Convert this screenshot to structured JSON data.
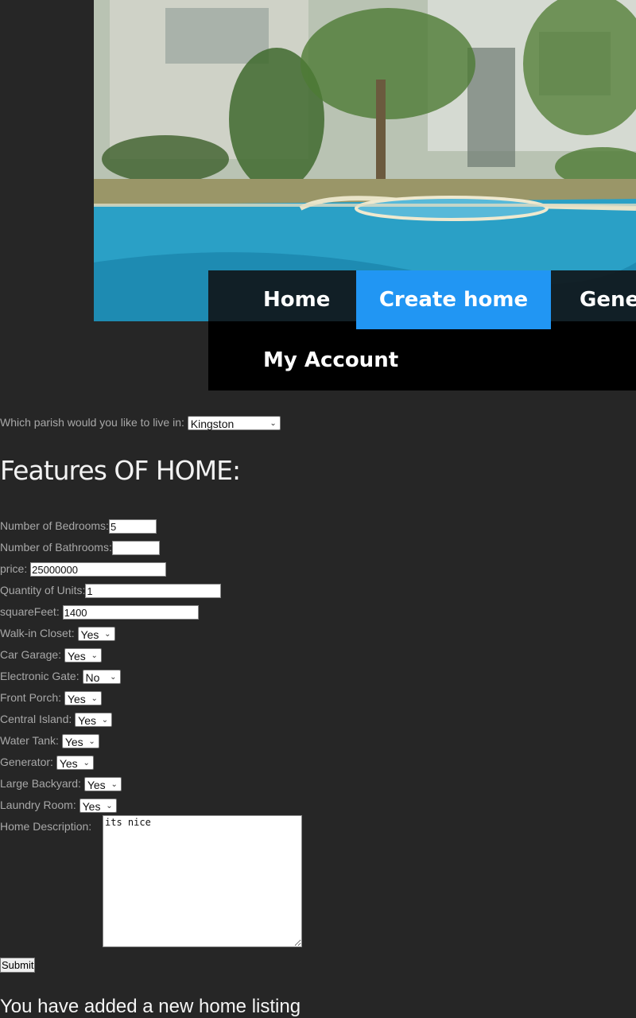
{
  "nav": {
    "home": "Home",
    "create_home": "Create home",
    "general": "Gene",
    "my_account": "My Account"
  },
  "colors": {
    "accent": "#2196f3",
    "background": "#262626"
  },
  "parish": {
    "label": "Which parish would you like to live in:",
    "value": "Kingston"
  },
  "features_heading": "Features OF HOME:",
  "fields": {
    "bedrooms": {
      "label": "Number of Bedrooms:",
      "value": "5"
    },
    "bathrooms": {
      "label": "Number of Bathrooms:",
      "value": ""
    },
    "price": {
      "label": "price:",
      "value": "25000000"
    },
    "units": {
      "label": "Quantity of Units:",
      "value": "1"
    },
    "squarefeet": {
      "label": "squareFeet:",
      "value": "1400"
    }
  },
  "options": {
    "walk_in_closet": {
      "label": "Walk-in Closet:",
      "value": "Yes"
    },
    "car_garage": {
      "label": "Car Garage:",
      "value": "Yes"
    },
    "electronic_gate": {
      "label": "Electronic Gate:",
      "value": "No"
    },
    "front_porch": {
      "label": "Front Porch:",
      "value": "Yes"
    },
    "central_island": {
      "label": "Central Island:",
      "value": "Yes"
    },
    "water_tank": {
      "label": "Water Tank:",
      "value": "Yes"
    },
    "generator": {
      "label": "Generator:",
      "value": "Yes"
    },
    "large_backyard": {
      "label": "Large Backyard:",
      "value": "Yes"
    },
    "laundry_room": {
      "label": "Laundry Room:",
      "value": "Yes"
    }
  },
  "description": {
    "label": "Home Description:",
    "value": "its nice"
  },
  "submit_label": "Submit",
  "result_message": "You have added a new home listing"
}
